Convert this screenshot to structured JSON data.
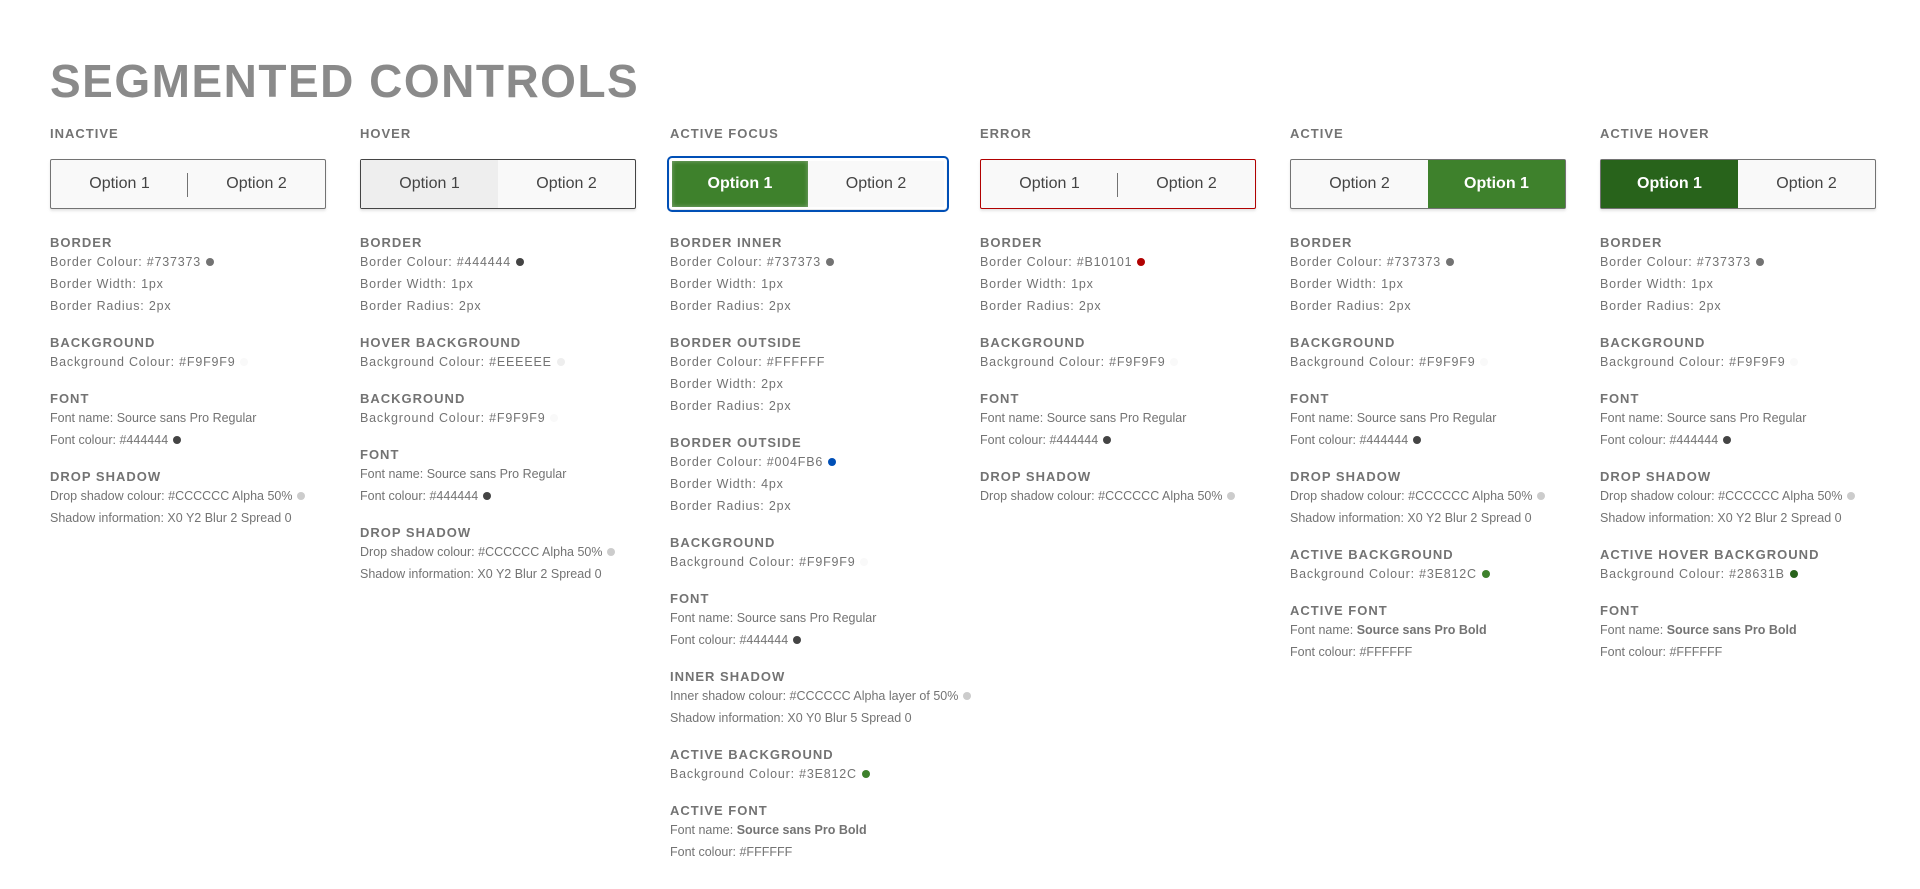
{
  "title": "SEGMENTED CONTROLS",
  "columns": [
    {
      "label": "INACTIVE",
      "options": [
        "Option 1",
        "Option 2"
      ],
      "groups": [
        {
          "head": "BORDER",
          "lines": [
            "Border Colour: #737373",
            "Border Width: 1px",
            "Border Radius: 2px"
          ]
        },
        {
          "head": "BACKGROUND",
          "lines": [
            "Background Colour: #F9F9F9"
          ]
        },
        {
          "head": "FONT",
          "lines": [
            "Font name: Source sans Pro Regular",
            "Font colour: #444444"
          ]
        },
        {
          "head": "DROP SHADOW",
          "lines": [
            "Drop shadow colour: #CCCCCC Alpha 50%",
            "Shadow information: X0 Y2 Blur 2 Spread 0"
          ]
        }
      ]
    },
    {
      "label": "HOVER",
      "options": [
        "Option 1",
        "Option 2"
      ],
      "groups": [
        {
          "head": "BORDER",
          "lines": [
            "Border Colour: #444444",
            "Border Width: 1px",
            "Border Radius: 2px"
          ]
        },
        {
          "head": "HOVER BACKGROUND",
          "lines": [
            "Background Colour: #EEEEEE"
          ]
        },
        {
          "head": "BACKGROUND",
          "lines": [
            "Background Colour: #F9F9F9"
          ]
        },
        {
          "head": "FONT",
          "lines": [
            "Font name: Source sans Pro Regular",
            "Font colour: #444444"
          ]
        },
        {
          "head": "DROP SHADOW",
          "lines": [
            "Drop shadow colour: #CCCCCC Alpha 50%",
            "Shadow information: X0 Y2 Blur 2 Spread 0"
          ]
        }
      ]
    },
    {
      "label": "ACTIVE FOCUS",
      "options": [
        "Option 1",
        "Option 2"
      ],
      "groups": [
        {
          "head": "BORDER INNER",
          "lines": [
            "Border Colour: #737373",
            "Border Width: 1px",
            "Border Radius: 2px"
          ]
        },
        {
          "head": "BORDER OUTSIDE",
          "lines": [
            "Border Colour: #FFFFFF",
            "Border Width: 2px",
            "Border Radius: 2px"
          ]
        },
        {
          "head": "BORDER OUTSIDE",
          "lines": [
            "Border Colour: #004FB6",
            "Border Width: 4px",
            "Border Radius: 2px"
          ]
        },
        {
          "head": "BACKGROUND",
          "lines": [
            "Background Colour: #F9F9F9"
          ]
        },
        {
          "head": "FONT",
          "lines": [
            "Font name: Source sans Pro Regular",
            "Font colour: #444444"
          ]
        },
        {
          "head": "INNER SHADOW",
          "lines": [
            "Inner shadow colour: #CCCCCC Alpha layer of 50%",
            "Shadow information: X0 Y0 Blur 5 Spread 0"
          ]
        },
        {
          "head": "ACTIVE BACKGROUND",
          "lines": [
            "Background Colour: #3E812C"
          ]
        },
        {
          "head": "ACTIVE FONT",
          "lines": [
            "Font name: Source sans Pro Bold",
            "Font colour: #FFFFFF"
          ]
        }
      ]
    },
    {
      "label": "ERROR",
      "options": [
        "Option 1",
        "Option 2"
      ],
      "groups": [
        {
          "head": "BORDER",
          "lines": [
            "Border Colour: #B10101",
            "Border Width: 1px",
            "Border Radius: 2px"
          ]
        },
        {
          "head": "BACKGROUND",
          "lines": [
            "Background Colour: #F9F9F9"
          ]
        },
        {
          "head": "FONT",
          "lines": [
            "Font name: Source sans Pro Regular",
            "Font colour: #444444"
          ]
        },
        {
          "head": "DROP SHADOW",
          "lines": [
            "Drop shadow colour: #CCCCCC Alpha 50%"
          ]
        }
      ]
    },
    {
      "label": "ACTIVE",
      "options": [
        "Option 2",
        "Option 1"
      ],
      "groups": [
        {
          "head": "BORDER",
          "lines": [
            "Border Colour: #737373",
            "Border Width: 1px",
            "Border Radius: 2px"
          ]
        },
        {
          "head": "BACKGROUND",
          "lines": [
            "Background Colour: #F9F9F9"
          ]
        },
        {
          "head": "FONT",
          "lines": [
            "Font name: Source sans Pro Regular",
            "Font colour: #444444"
          ]
        },
        {
          "head": "DROP SHADOW",
          "lines": [
            "Drop shadow colour: #CCCCCC Alpha 50%",
            "Shadow information: X0 Y2 Blur 2 Spread 0"
          ]
        },
        {
          "head": "ACTIVE BACKGROUND",
          "lines": [
            "Background Colour: #3E812C"
          ]
        },
        {
          "head": "ACTIVE FONT",
          "lines": [
            "Font name: Source sans Pro Bold",
            "Font colour: #FFFFFF"
          ]
        }
      ]
    },
    {
      "label": "ACTIVE HOVER",
      "options": [
        "Option 1",
        "Option 2"
      ],
      "groups": [
        {
          "head": "BORDER",
          "lines": [
            "Border Colour: #737373",
            "Border Width: 1px",
            "Border Radius: 2px"
          ]
        },
        {
          "head": "BACKGROUND",
          "lines": [
            "Background Colour: #F9F9F9"
          ]
        },
        {
          "head": "FONT",
          "lines": [
            "Font name: Source sans Pro Regular",
            "Font colour: #444444"
          ]
        },
        {
          "head": "DROP SHADOW",
          "lines": [
            "Drop shadow colour: #CCCCCC Alpha 50%",
            "Shadow information: X0 Y2 Blur 2 Spread 0"
          ]
        },
        {
          "head": "ACTIVE HOVER BACKGROUND",
          "lines": [
            "Background Colour: #28631B"
          ]
        },
        {
          "head": "FONT",
          "lines": [
            "Font name: Source sans Pro Bold",
            "Font colour: #FFFFFF"
          ]
        }
      ]
    }
  ],
  "colors": {
    "text": "#737373",
    "inactive_border": "#737373",
    "hover_border": "#444444",
    "error_border": "#B10101",
    "focus_ring": "#004FB6",
    "active_bg": "#3E812C",
    "active_hover_bg": "#28631B",
    "hover_bg": "#EEEEEE",
    "bg": "#F9F9F9"
  }
}
